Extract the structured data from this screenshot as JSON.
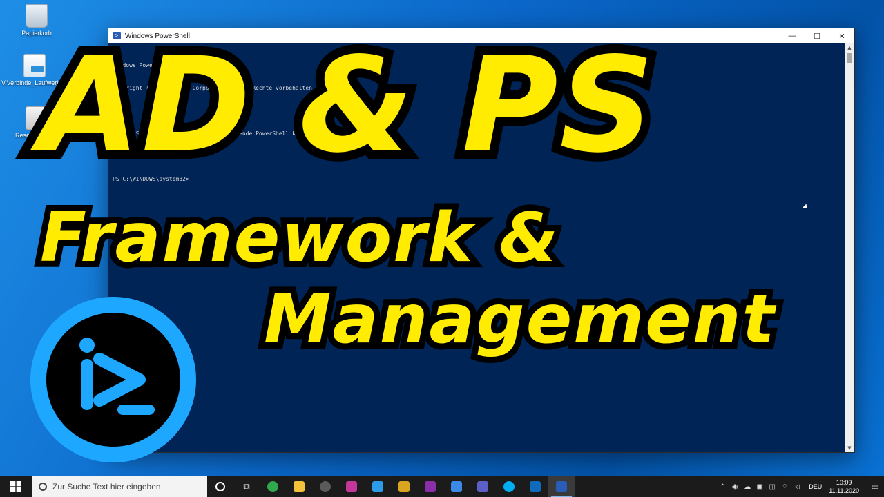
{
  "desktop": {
    "icons": [
      {
        "label": "Papierkorb"
      },
      {
        "label": "V.Verbinde_Laufwerke..."
      },
      {
        "label": "ResetWUEng..."
      }
    ]
  },
  "powershell": {
    "title": "Windows PowerShell",
    "lines": [
      "Windows PowerShell",
      "Copyright (C) Microsoft Corporation. Alle Rechte vorbehalten.",
      "",
      "Lernen Sie das neue plattformübergreifende PowerShell kennen – https://aka.ms/pscore6",
      "",
      "PS C:\\WINDOWS\\system32>"
    ]
  },
  "overlay": {
    "line1": "AD & PS",
    "line2": "Framework &",
    "line3": "Management"
  },
  "taskbar": {
    "search_placeholder": "Zur Suche Text hier eingeben",
    "apps": [
      {
        "icon": "cortana-icon",
        "color": "#ffffff"
      },
      {
        "icon": "task-view-icon",
        "color": "#ffffff"
      },
      {
        "icon": "edge-icon",
        "color": "#2fa84f"
      },
      {
        "icon": "file-explorer-icon",
        "color": "#f3c13a"
      },
      {
        "icon": "davinci-resolve-icon",
        "color": "#5a5a5a"
      },
      {
        "icon": "affinity-publisher-icon",
        "color": "#c3379a"
      },
      {
        "icon": "affinity-designer-icon",
        "color": "#2e9be8"
      },
      {
        "icon": "app-yellow-icon",
        "color": "#d9a520"
      },
      {
        "icon": "onenote-icon",
        "color": "#8b2fa8"
      },
      {
        "icon": "todo-icon",
        "color": "#3b8ae8"
      },
      {
        "icon": "teams-icon",
        "color": "#5b5fc7"
      },
      {
        "icon": "skype-icon",
        "color": "#00aff0"
      },
      {
        "icon": "outlook-icon",
        "color": "#0f6cbd"
      },
      {
        "icon": "powershell-icon",
        "color": "#2a5cb8"
      }
    ],
    "language": "DEU",
    "time": "10:09",
    "date": "11.11.2020"
  },
  "colors": {
    "overlay_text": "#ffec00",
    "ps_background": "#012456",
    "logo_ring": "#1ea7ff"
  }
}
